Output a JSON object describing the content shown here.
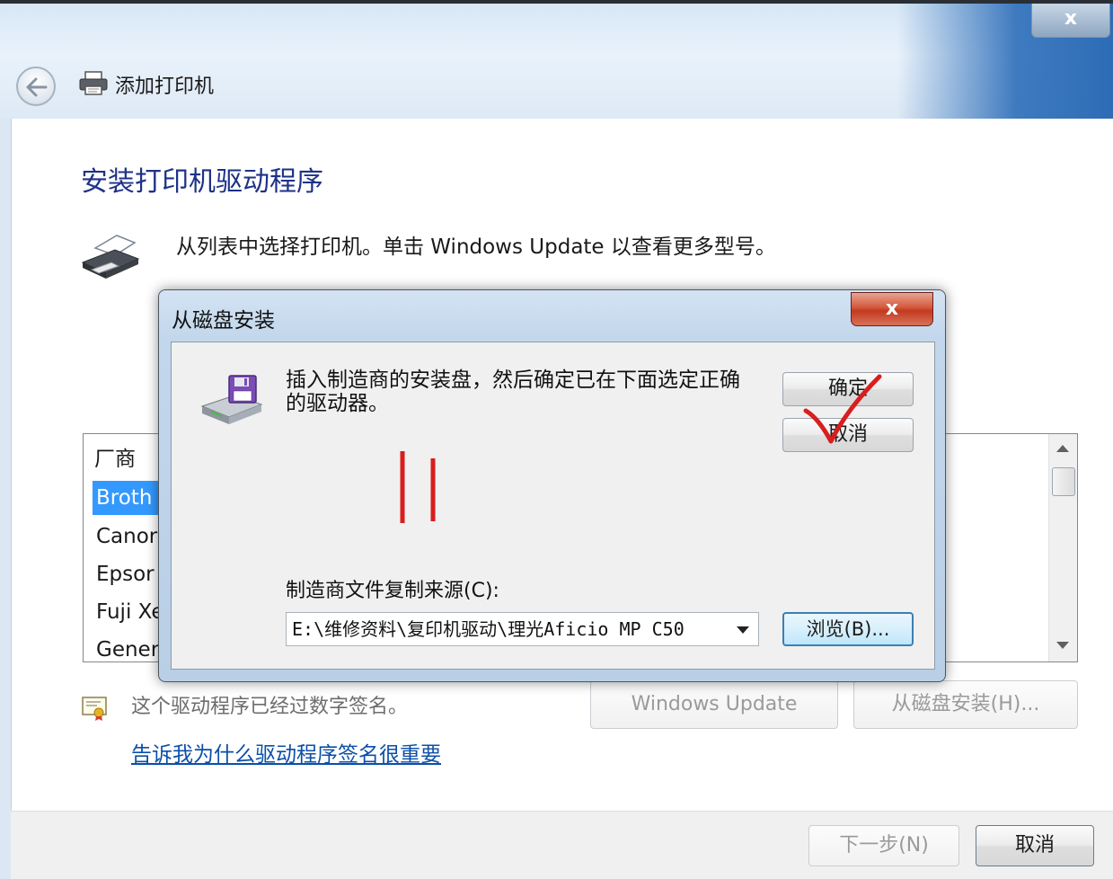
{
  "window": {
    "title": "添加打印机",
    "close_glyph": "x"
  },
  "page": {
    "heading": "安装打印机驱动程序",
    "instruction": "从列表中选择打印机。单击 Windows Update 以查看更多型号。"
  },
  "manufacturer_list": {
    "header": "厂商",
    "items": [
      {
        "label": "Broth",
        "selected": true
      },
      {
        "label": "Canor",
        "selected": false
      },
      {
        "label": "Epsor",
        "selected": false
      },
      {
        "label": "Fuji Xe",
        "selected": false
      },
      {
        "label": "Gener",
        "selected": false
      }
    ]
  },
  "signature": {
    "text": "这个驱动程序已经过数字签名。",
    "link": "告诉我为什么驱动程序签名很重要"
  },
  "buttons": {
    "windows_update": "Windows Update",
    "from_disk": "从磁盘安装(H)...",
    "next": "下一步(N)",
    "cancel": "取消"
  },
  "dialog": {
    "title": "从磁盘安装",
    "close_glyph": "x",
    "message": "插入制造商的安装盘，然后确定已在下面选定正确的驱动器。",
    "ok": "确定",
    "cancel": "取消",
    "source_label": "制造商文件复制来源(C):",
    "source_value": "E:\\维修资料\\复印机驱动\\理光Aficio MP C50",
    "browse": "浏览(B)..."
  },
  "icons": {
    "back": "back-arrow-icon",
    "title_printer": "printer-icon",
    "big_printer": "printer-icon",
    "disk": "floppy-disk-drive-icon",
    "certificate": "certificate-icon"
  },
  "colors": {
    "heading": "#1e3287",
    "selection": "#3399ff",
    "link": "#0b4fa8",
    "annotation": "#d81e1e"
  }
}
